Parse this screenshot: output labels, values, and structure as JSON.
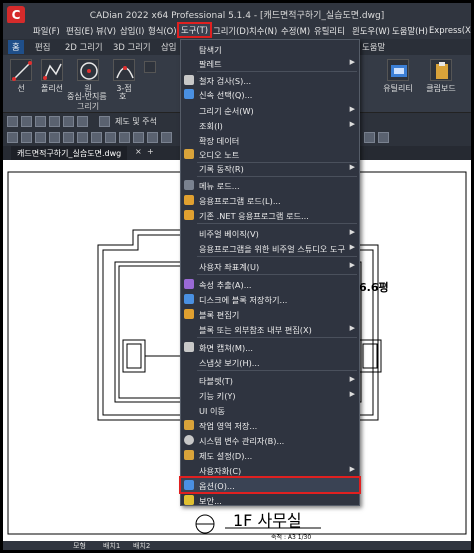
{
  "window": {
    "title": "CADian 2022 x64 Professional 5.1.4 - [캐드면적구하기_실습도면.dwg]",
    "logo": "C"
  },
  "menubar": {
    "items": [
      "파일(F)",
      "편집(E)",
      "뷰(V)",
      "삽입(I)",
      "형식(O)",
      "도구(T)",
      "그리기(D)",
      "치수(N)",
      "수정(M)",
      "유틸리티",
      "윈도우(W)",
      "도움말(H)",
      "Express(X)"
    ]
  },
  "ribbon": {
    "tabs": [
      "홈",
      "편집",
      "2D 그리기",
      "3D 그리기",
      "삽입"
    ],
    "tools": [
      "선",
      "폴리선",
      "원",
      "3-점",
      "호"
    ],
    "tool_caption": "중심-반지름",
    "panel_label": "그리기",
    "right_panels": [
      "유틸리티",
      "클립보드"
    ],
    "help_tab": "도움말"
  },
  "toolbar": {
    "view_label": "제도 및 주석"
  },
  "document": {
    "tab_label": "캐드면적구하기_실습도면.dwg",
    "add_tab": "+"
  },
  "drawing": {
    "area_label": "6.6평",
    "title": "1F 사무실",
    "scale_note": "축척 : A3 1/30"
  },
  "layout_tabs": [
    "모형",
    "배치1",
    "배치2"
  ],
  "dropdown": {
    "items": [
      {
        "label": "탐색기",
        "submenu": false,
        "icon": "none"
      },
      {
        "label": "팔레트",
        "submenu": true,
        "icon": "none"
      },
      {
        "label": "철자 검사(S)...",
        "submenu": false,
        "icon": "spell-icon"
      },
      {
        "label": "신속 선택(Q)...",
        "submenu": false,
        "icon": "quick-select-icon"
      },
      {
        "label": "그리기 순서(W)",
        "submenu": true,
        "icon": "none"
      },
      {
        "label": "조회(I)",
        "submenu": true,
        "icon": "none"
      },
      {
        "label": "확장 데이터",
        "submenu": false,
        "icon": "none"
      },
      {
        "label": "오디오 노트",
        "submenu": false,
        "icon": "audio-icon"
      },
      {
        "label": "기록 동작(R)",
        "submenu": true,
        "icon": "none"
      },
      {
        "label": "메뉴 로드...",
        "submenu": false,
        "icon": "menu-load-icon"
      },
      {
        "label": "응용프로그램 로드(L)...",
        "submenu": false,
        "icon": "app-load-icon"
      },
      {
        "label": "기존 .NET 응용프로그램 로드...",
        "submenu": false,
        "icon": "net-load-icon"
      },
      {
        "label": "비주얼 베이직(V)",
        "submenu": true,
        "icon": "none"
      },
      {
        "label": "응용프로그램을 위한 비주얼 스튜디오 도구",
        "submenu": true,
        "icon": "none"
      },
      {
        "label": "사용자 좌표계(U)",
        "submenu": true,
        "icon": "none"
      },
      {
        "label": "속성 추출(A)...",
        "submenu": false,
        "icon": "attribute-icon"
      },
      {
        "label": "디스크에 블록 저장하기...",
        "submenu": false,
        "icon": "block-save-icon"
      },
      {
        "label": "블록 편집기",
        "submenu": false,
        "icon": "block-editor-icon"
      },
      {
        "label": "블록 또는 외부참조 내부 편집(X)",
        "submenu": true,
        "icon": "none"
      },
      {
        "label": "화면 캡쳐(M)...",
        "submenu": false,
        "icon": "capture-icon"
      },
      {
        "label": "스냅샷 보기(H)...",
        "submenu": false,
        "icon": "none"
      },
      {
        "label": "타블렛(T)",
        "submenu": true,
        "icon": "none"
      },
      {
        "label": "기능 키(Y)",
        "submenu": true,
        "icon": "none"
      },
      {
        "label": "UI 이동",
        "submenu": false,
        "icon": "none"
      },
      {
        "label": "작업 영역 저장...",
        "submenu": false,
        "icon": "workspace-icon"
      },
      {
        "label": "시스템 변수 관리자(B)...",
        "submenu": false,
        "icon": "gear-icon"
      },
      {
        "label": "제도 설정(D)...",
        "submenu": false,
        "icon": "drafting-icon"
      },
      {
        "label": "사용자화(C)",
        "submenu": true,
        "icon": "none"
      },
      {
        "label": "옵션(O)...",
        "submenu": false,
        "icon": "options-icon"
      },
      {
        "label": "보안...",
        "submenu": false,
        "icon": "warning-icon"
      }
    ]
  }
}
